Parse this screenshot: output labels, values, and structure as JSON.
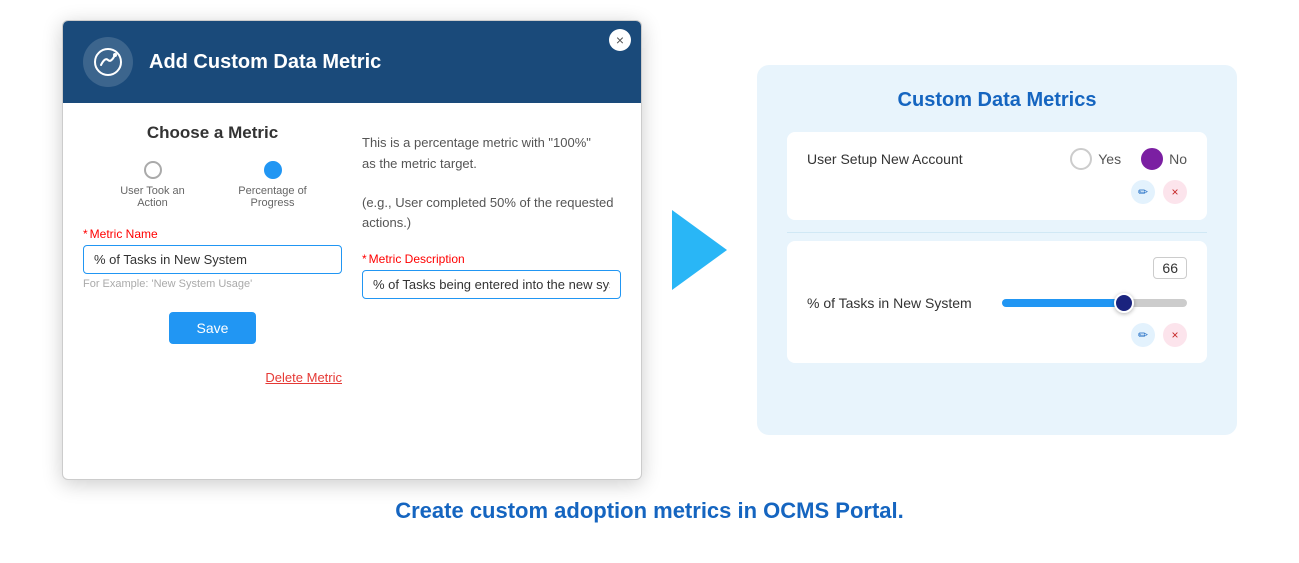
{
  "modal": {
    "title": "Add Custom Data Metric",
    "close_label": "×",
    "section_title": "Choose a Metric",
    "options": [
      {
        "id": "action",
        "label": "User Took an Action",
        "selected": false
      },
      {
        "id": "progress",
        "label": "Percentage of Progress",
        "selected": true
      }
    ],
    "description_line1": "This is a percentage metric with \"100%\"",
    "description_line2": "as the metric target.",
    "description_example": "(e.g., User completed 50% of the requested actions.)",
    "metric_name_label": "Metric Name",
    "metric_name_required": "*",
    "metric_name_value": "% of Tasks in New System",
    "metric_name_placeholder": "% of Tasks in New System",
    "metric_name_hint": "For Example: 'New System Usage'",
    "metric_desc_label": "Metric Description",
    "metric_desc_required": "*",
    "metric_desc_value": "% of Tasks being entered into the new system",
    "metric_desc_placeholder": "% of Tasks being entered into the new system",
    "save_label": "Save",
    "delete_label": "Delete Metric"
  },
  "right_panel": {
    "title": "Custom Data Metrics",
    "metric1": {
      "name": "User Setup New Account",
      "yes_label": "Yes",
      "no_label": "No",
      "selected": "no"
    },
    "metric2": {
      "name": "% of Tasks in New System",
      "value": "66",
      "slider_percent": 66
    },
    "edit_icon": "✏",
    "remove_icon": "×"
  },
  "caption": "Create custom adoption metrics in OCMS Portal."
}
